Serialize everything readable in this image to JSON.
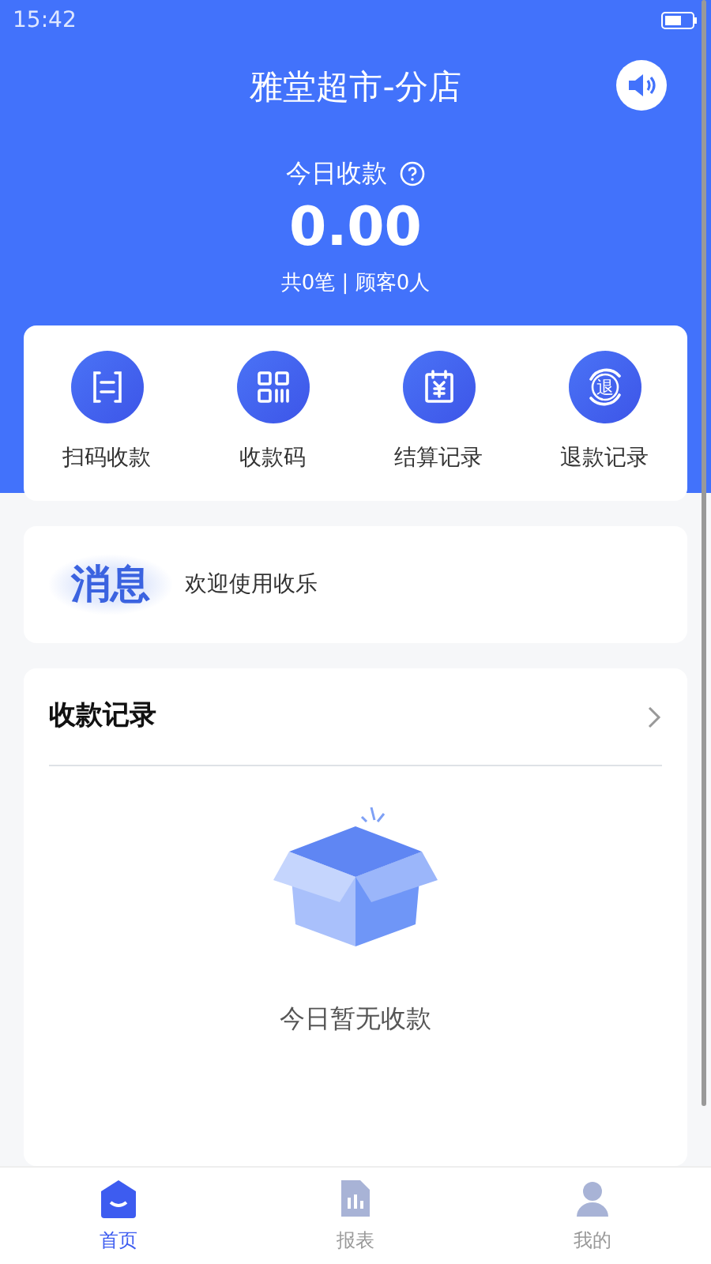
{
  "status_bar": {
    "time": "15:42"
  },
  "header": {
    "title": "雅堂超市-分店",
    "summary_label": "今日收款",
    "amount": "0.00",
    "stats": "共0笔 | 顾客0人"
  },
  "actions": [
    {
      "kind": "scan",
      "label": "扫码收款"
    },
    {
      "kind": "qr",
      "label": "收款码"
    },
    {
      "kind": "settle",
      "label": "结算记录"
    },
    {
      "kind": "refund",
      "label": "退款记录",
      "icon_text": "退"
    }
  ],
  "notice": {
    "badge": "消息",
    "text": "欢迎使用收乐"
  },
  "records": {
    "title": "收款记录",
    "empty_text": "今日暂无收款"
  },
  "tabs": [
    {
      "kind": "home",
      "label": "首页",
      "selected": true
    },
    {
      "kind": "report",
      "label": "报表",
      "selected": false
    },
    {
      "kind": "me",
      "label": "我的",
      "selected": false
    }
  ]
}
